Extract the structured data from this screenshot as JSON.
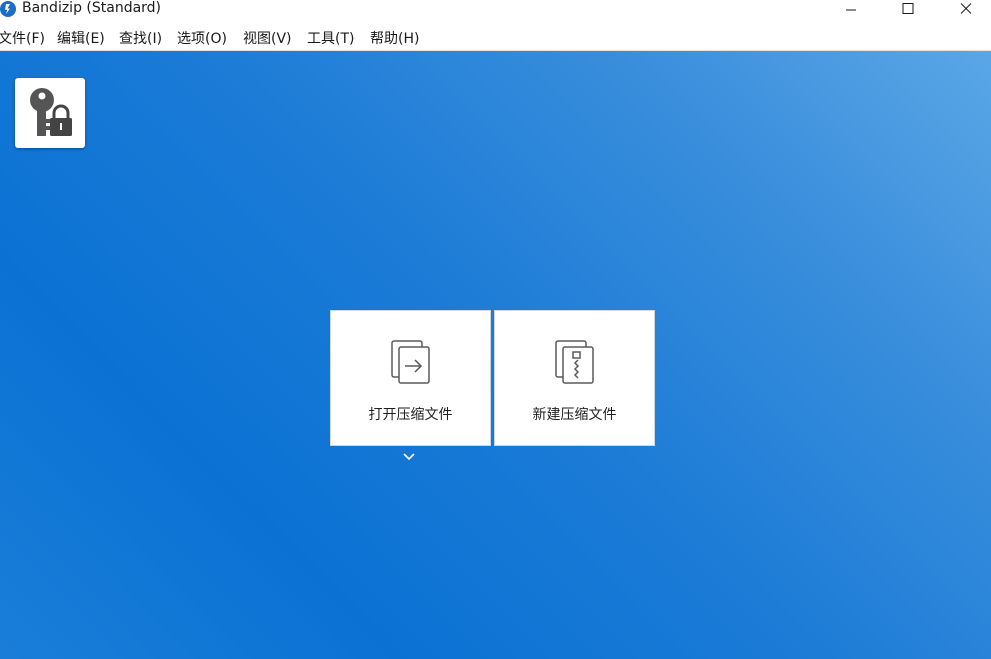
{
  "window": {
    "title": "Bandizip (Standard)",
    "icon": "bandizip-logo-icon",
    "controls": [
      "minimize-icon",
      "maximize-icon",
      "close-icon"
    ]
  },
  "menu": {
    "items": [
      {
        "label": "文件(F)"
      },
      {
        "label": "编辑(E)"
      },
      {
        "label": "查找(I)"
      },
      {
        "label": "选项(O)"
      },
      {
        "label": "视图(V)"
      },
      {
        "label": "工具(T)"
      },
      {
        "label": "帮助(H)"
      }
    ]
  },
  "toolbar": {
    "password_button_icon": "key-lock-icon"
  },
  "main": {
    "tiles": [
      {
        "label": "打开压缩文件",
        "icon": "open-archive-icon"
      },
      {
        "label": "新建压缩文件",
        "icon": "new-archive-icon"
      }
    ],
    "dropdown_icon": "chevron-down-icon"
  },
  "colors": {
    "background_top_right": "#5aa7e6",
    "background_bottom_left": "#0b72d4",
    "tile_background": "#ffffff"
  }
}
